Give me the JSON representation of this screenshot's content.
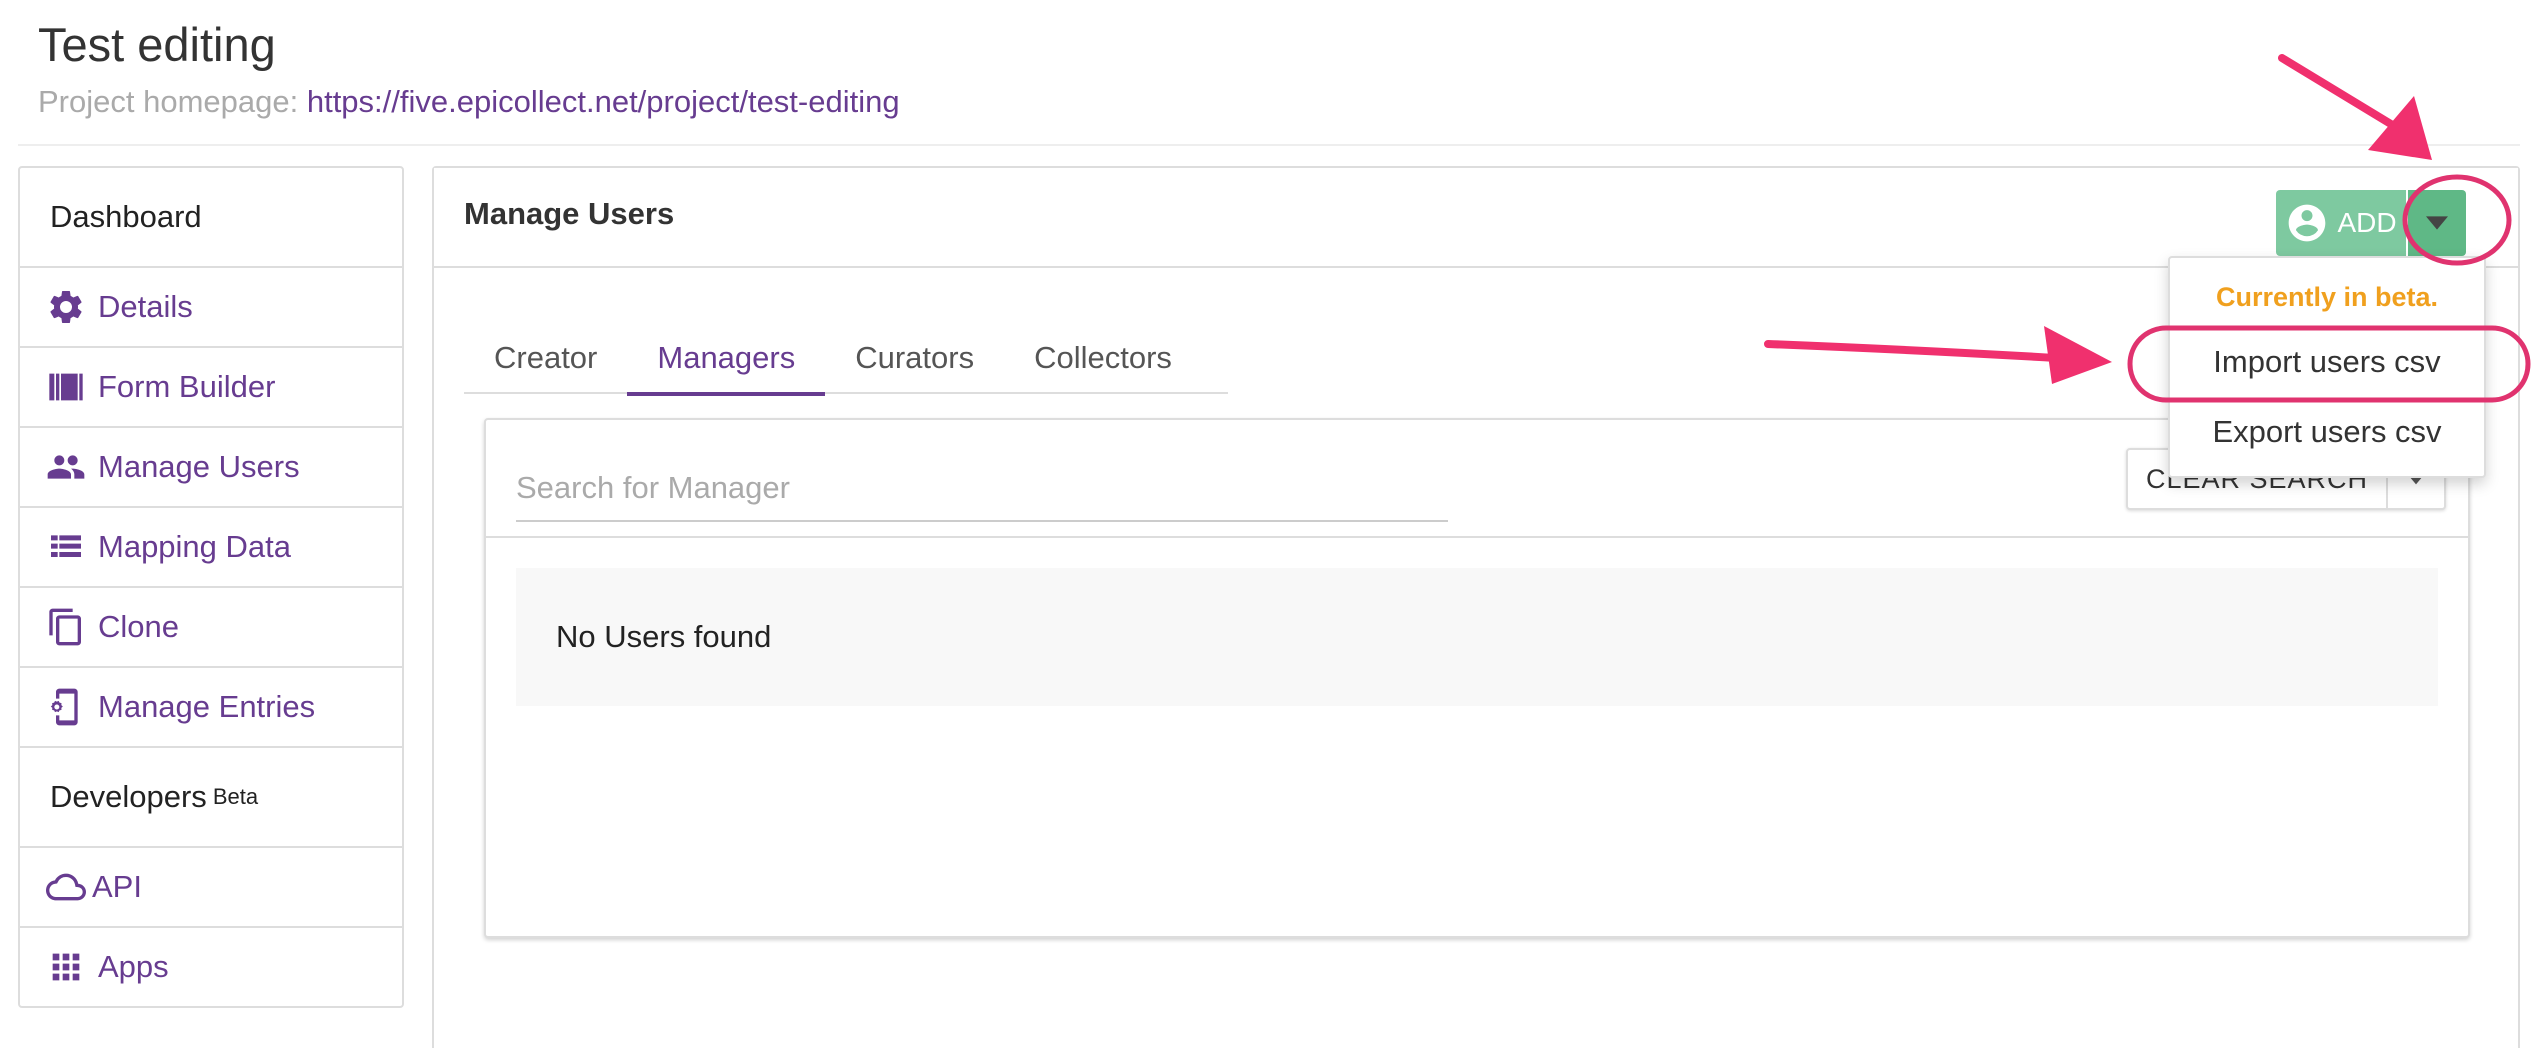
{
  "project": {
    "title": "Test editing",
    "homepage_label": "Project homepage:",
    "homepage_url": "https://five.epicollect.net/project/test-editing"
  },
  "sidebar": {
    "dashboard": "Dashboard",
    "items": [
      {
        "label": "Details",
        "icon": "gear-icon"
      },
      {
        "label": "Form Builder",
        "icon": "form-builder-icon"
      },
      {
        "label": "Manage Users",
        "icon": "users-icon"
      },
      {
        "label": "Mapping Data",
        "icon": "list-icon"
      },
      {
        "label": "Clone",
        "icon": "copy-icon"
      },
      {
        "label": "Manage Entries",
        "icon": "phone-settings-icon"
      }
    ],
    "developers": "Developers",
    "developers_badge": "Beta",
    "dev_items": [
      {
        "label": "API",
        "icon": "cloud-icon"
      },
      {
        "label": "Apps",
        "icon": "apps-grid-icon"
      }
    ]
  },
  "panel": {
    "title": "Manage Users",
    "add_label": "ADD",
    "tabs": [
      "Creator",
      "Managers",
      "Curators",
      "Collectors"
    ],
    "active_tab": "Managers",
    "search_placeholder": "Search for Manager",
    "clear_label": "CLEAR SEARCH",
    "empty_message": "No Users found"
  },
  "dropdown": {
    "header": "Currently in beta.",
    "items": [
      "Import users csv",
      "Export users csv"
    ]
  },
  "colors": {
    "brand_purple": "#673C90",
    "add_green": "#7ec9a0",
    "beta_orange": "#f0a01e",
    "annotation_pink": "#f0306e"
  }
}
